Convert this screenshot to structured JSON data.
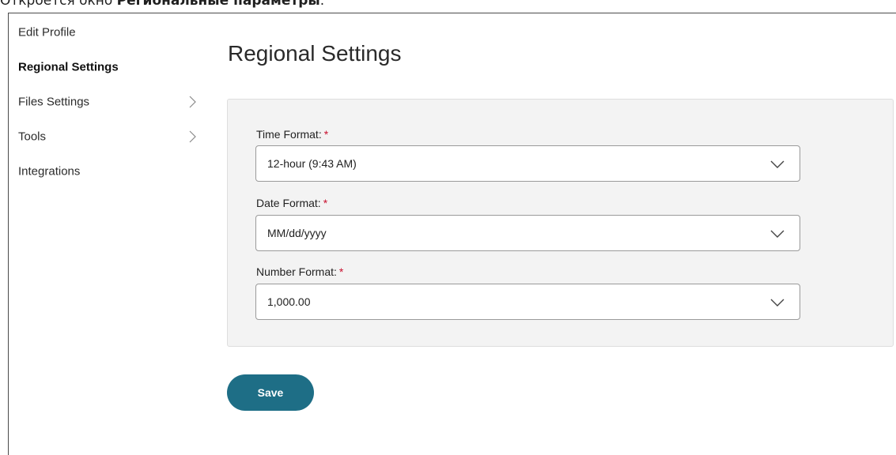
{
  "caption": {
    "prefix": "Откроется окно ",
    "bold": "Региональные параметры",
    "suffix": "."
  },
  "sidebar": {
    "items": [
      {
        "label": "Edit Profile",
        "active": false,
        "has_submenu": false
      },
      {
        "label": "Regional Settings",
        "active": true,
        "has_submenu": false
      },
      {
        "label": "Files Settings",
        "active": false,
        "has_submenu": true
      },
      {
        "label": "Tools",
        "active": false,
        "has_submenu": true
      },
      {
        "label": "Integrations",
        "active": false,
        "has_submenu": false
      }
    ]
  },
  "main": {
    "title": "Regional Settings",
    "fields": {
      "time": {
        "label": "Time Format:",
        "required_mark": "*",
        "value": "12-hour (9:43 AM)"
      },
      "date": {
        "label": "Date Format:",
        "required_mark": "*",
        "value": "MM/dd/yyyy"
      },
      "number": {
        "label": "Number Format:",
        "required_mark": "*",
        "value": "1,000.00"
      }
    },
    "save_label": "Save"
  },
  "colors": {
    "primary_button": "#1e6e86",
    "required_mark": "#c8102e",
    "panel_background": "#f3f3f3"
  },
  "icons": {
    "submenu": "chevron-right-icon",
    "select": "chevron-down-icon"
  }
}
